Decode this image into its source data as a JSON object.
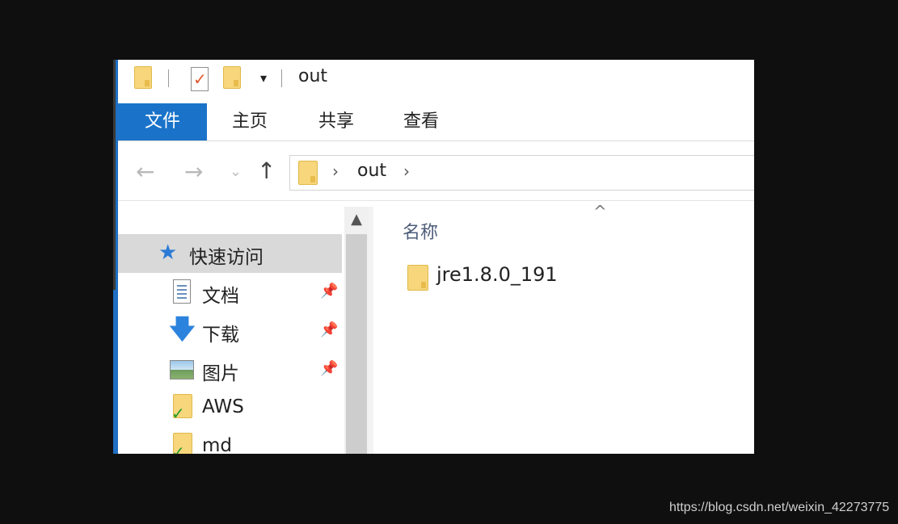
{
  "window": {
    "title": "out",
    "qat_dropdown_glyph": "▾"
  },
  "ribbon": {
    "tabs": [
      "文件",
      "主页",
      "共享",
      "查看"
    ]
  },
  "navbar": {
    "back_glyph": "←",
    "forward_glyph": "→",
    "recent_glyph": "⌄",
    "up_glyph": "↑",
    "address": {
      "separator": "›",
      "path": "out"
    }
  },
  "nav_pane": {
    "quick_access": "快速访问",
    "items": [
      {
        "label": "文档",
        "icon": "documents-icon",
        "pinned": true
      },
      {
        "label": "下载",
        "icon": "downloads-icon",
        "pinned": true
      },
      {
        "label": "图片",
        "icon": "pictures-icon",
        "pinned": true
      },
      {
        "label": "AWS",
        "icon": "synced-folder-icon",
        "pinned": false
      },
      {
        "label": "md",
        "icon": "synced-folder-icon",
        "pinned": false
      }
    ],
    "pin_glyph": "📌"
  },
  "content": {
    "column_header": "名称",
    "sort_glyph": "^",
    "files": [
      {
        "name": "jre1.8.0_191",
        "icon": "folder-icon"
      }
    ]
  },
  "watermark": "https://blog.csdn.net/weixin_42273775",
  "colors": {
    "accent": "#1a73c9",
    "folder": "#f7d67c",
    "selection": "#d9d9d9"
  }
}
